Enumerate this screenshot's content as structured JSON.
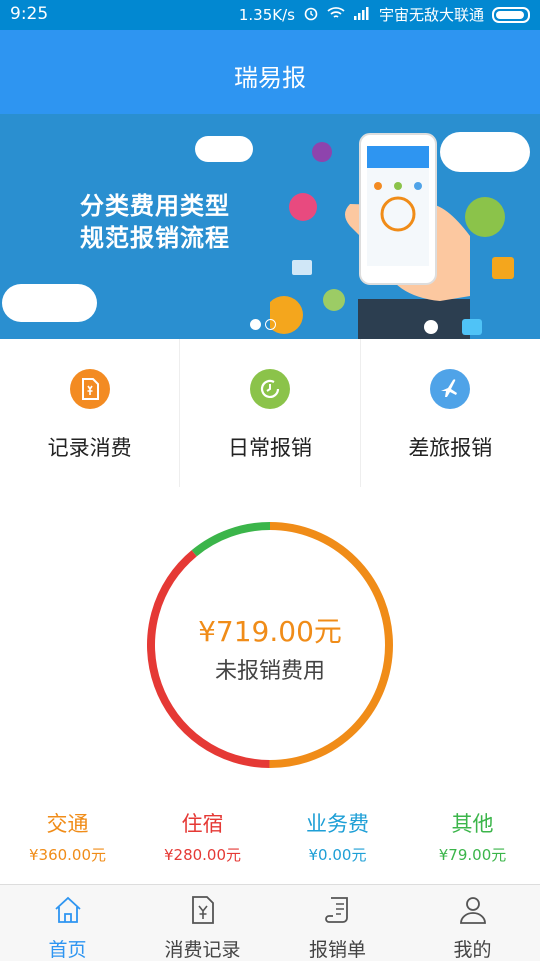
{
  "status_bar": {
    "time": "9:25",
    "net_speed": "1.35K/s",
    "carrier": "宇宙无敌大联通"
  },
  "app_bar": {
    "title": "瑞易报"
  },
  "banner": {
    "line1": "分类费用类型",
    "line2": "规范报销流程",
    "colors": {
      "background": "#2a8fd0"
    }
  },
  "quick_actions": [
    {
      "label": "记录消费",
      "icon": "receipt-icon",
      "color": "#f38b22"
    },
    {
      "label": "日常报销",
      "icon": "clock-icon",
      "color": "#8bc34a"
    },
    {
      "label": "差旅报销",
      "icon": "airplane-icon",
      "color": "#4fa3e8"
    }
  ],
  "summary": {
    "amount": "¥719.00元",
    "caption": "未报销费用"
  },
  "categories": [
    {
      "name": "交通",
      "amount": "¥360.00元",
      "color": "#f08c18",
      "value": 360
    },
    {
      "name": "住宿",
      "amount": "¥280.00元",
      "color": "#e53935",
      "value": 280
    },
    {
      "name": "业务费",
      "amount": "¥0.00元",
      "color": "#1e9fd6",
      "value": 0
    },
    {
      "name": "其他",
      "amount": "¥79.00元",
      "color": "#3bb54a",
      "value": 79
    }
  ],
  "tabs": [
    {
      "label": "首页",
      "icon": "home-icon",
      "active": true
    },
    {
      "label": "消费记录",
      "icon": "document-yen-icon",
      "active": false
    },
    {
      "label": "报销单",
      "icon": "scroll-icon",
      "active": false
    },
    {
      "label": "我的",
      "icon": "person-icon",
      "active": false
    }
  ]
}
